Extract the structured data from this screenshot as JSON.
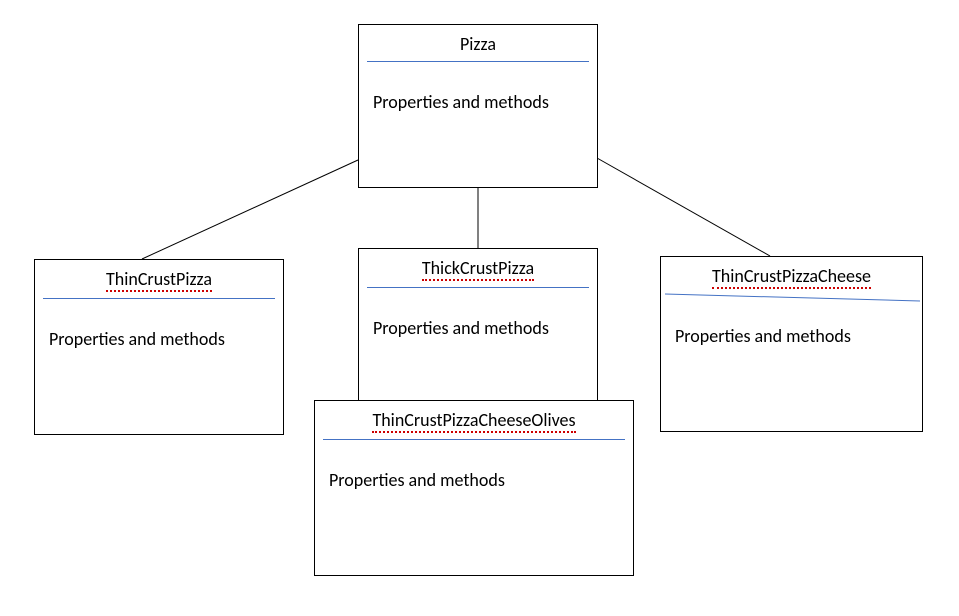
{
  "diagram": {
    "classes": {
      "pizza": {
        "title": "Pizza",
        "body": "Properties and methods"
      },
      "thinCrust": {
        "title": "ThinCrustPizza",
        "body": "Properties and methods"
      },
      "thickCrust": {
        "title": "ThickCrustPizza",
        "body": "Properties and methods"
      },
      "thinCrustCheese": {
        "title": "ThinCrustPizzaCheese",
        "body": "Properties and methods"
      },
      "thinCrustCheeseOlives": {
        "title": "ThinCrustPizzaCheeseOlives",
        "body": "Properties and methods"
      }
    }
  }
}
